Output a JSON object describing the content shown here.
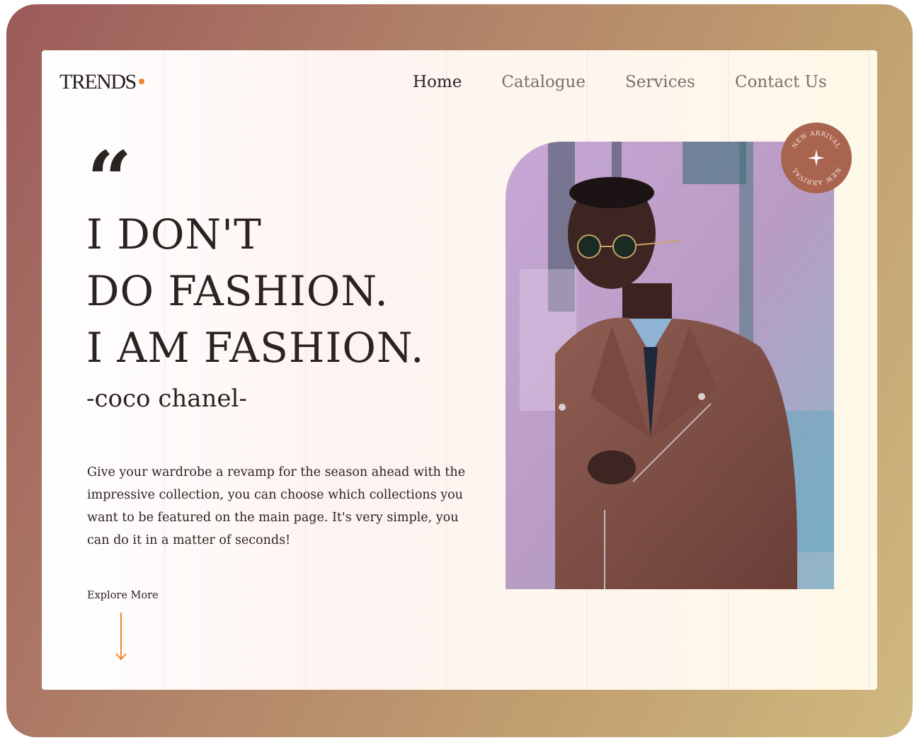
{
  "brand": {
    "logo_text": "TRENDS",
    "accent_color": "#f0862a"
  },
  "nav": {
    "items": [
      {
        "label": "Home",
        "active": true
      },
      {
        "label": "Catalogue",
        "active": false
      },
      {
        "label": "Services",
        "active": false
      },
      {
        "label": "Contact Us",
        "active": false
      }
    ]
  },
  "hero": {
    "quote_mark": "“",
    "headline_lines": [
      "I DON'T",
      "DO FASHION.",
      "I AM FASHION."
    ],
    "author": "-coco chanel-",
    "description": "Give your wardrobe a revamp for the season ahead with the impressive collection, you can choose which collections you want to be featured on the main page. It's very simple, you can do it in a matter of seconds!",
    "explore_label": "Explore More",
    "arrow_icon": "arrow-down-icon"
  },
  "badge": {
    "text": "NEW ARRIVAL",
    "color": "#a9644f",
    "icon": "sparkle-star-icon"
  },
  "photo": {
    "subject": "man-in-leather-jacket-photo"
  }
}
